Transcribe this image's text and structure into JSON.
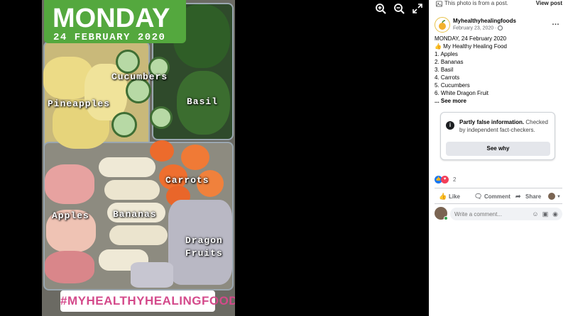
{
  "photo": {
    "day": "MONDAY",
    "date": "24 FEBRUARY 2020",
    "labels": {
      "pineapples": "Pineapples",
      "cucumbers": "Cucumbers",
      "basil": "Basil",
      "carrots": "Carrots",
      "apples": "Apples",
      "bananas": "Bananas",
      "dragon_line1": "Dragon",
      "dragon_line2": "Fruits"
    },
    "hashtag": "#MYHEALTHYHEALINGFOODS"
  },
  "viewer": {
    "icons": [
      "zoom-in-icon",
      "zoom-out-icon",
      "fullscreen-icon"
    ]
  },
  "panel": {
    "notice": "This photo is from a post.",
    "view_post": "View post",
    "page_name": "Myhealthyhealingfoods",
    "post_date": "February 23, 2020 ·",
    "more": "…",
    "body": [
      "MONDAY, 24 February 2020",
      "👍 My Healthy Healing Food",
      "1. Apples",
      "2. Bananas",
      "3. Basil",
      "4. Carrots",
      "5. Cucumbers",
      "6. White Dragon Fruit"
    ],
    "see_more": "... See more",
    "fact_check": {
      "title": "Partly false information.",
      "text": "Checked by independent fact-checkers.",
      "button": "See why"
    },
    "reaction_count": "2",
    "actions": {
      "like": "Like",
      "comment": "Comment",
      "share": "Share"
    },
    "comment_placeholder": "Write a comment...",
    "colors": {
      "badge_green": "#54a83e",
      "hashtag_pink": "#d44a8b",
      "like_blue": "#1877f2",
      "love_red": "#f33e58"
    }
  }
}
